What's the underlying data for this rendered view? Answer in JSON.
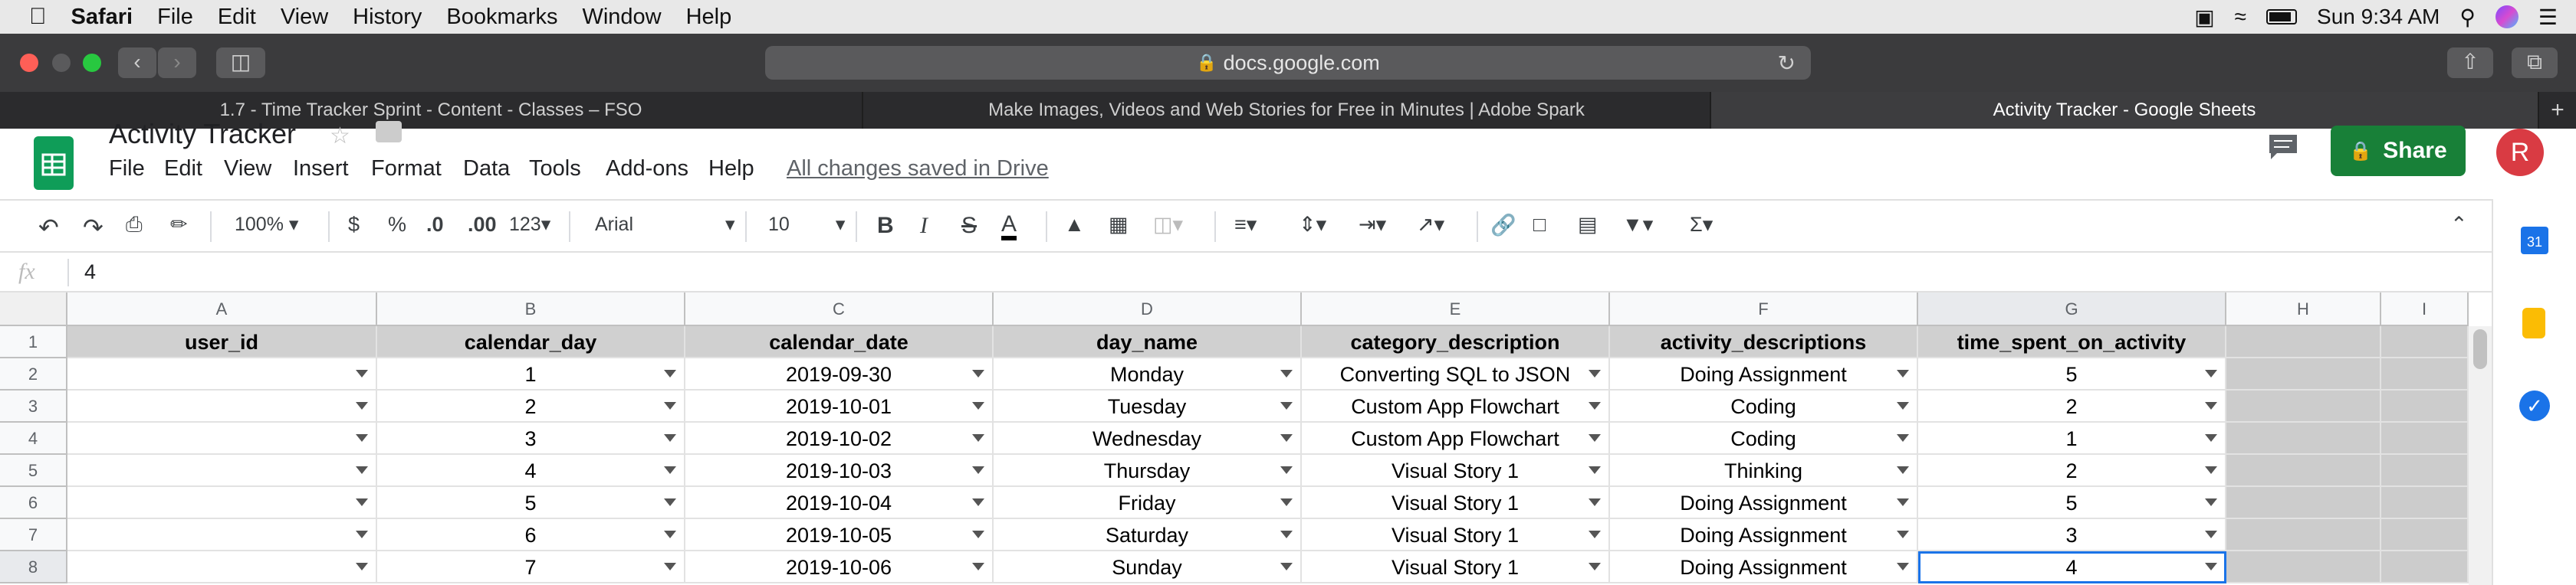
{
  "menubar": {
    "app": "Safari",
    "items": [
      "File",
      "Edit",
      "View",
      "History",
      "Bookmarks",
      "Window",
      "Help"
    ],
    "clock": "Sun 9:34 AM"
  },
  "browser": {
    "address": "docs.google.com",
    "tabs": [
      "1.7 - Time Tracker Sprint - Content - Classes – FSO",
      "Make Images, Videos and Web Stories for Free in Minutes | Adobe Spark",
      "Activity Tracker - Google Sheets"
    ],
    "active_tab": 2
  },
  "sheets": {
    "title": "Activity Tracker",
    "menu": [
      "File",
      "Edit",
      "View",
      "Insert",
      "Format",
      "Data",
      "Tools",
      "Add-ons",
      "Help"
    ],
    "saved_status": "All changes saved in Drive",
    "share_label": "Share",
    "avatar_letter": "R",
    "toolbar": {
      "zoom": "100%",
      "currency": "$",
      "percent": "%",
      "dec_less": ".0",
      "dec_more": ".00",
      "more_formats": "123",
      "font": "Arial",
      "font_size": "10",
      "bold": "B",
      "italic": "I",
      "strike": "S",
      "text_color": "A"
    },
    "formula_bar": {
      "fx": "fx",
      "value": "4"
    },
    "side_panel": {
      "calendar_day": "31"
    },
    "columns": [
      "A",
      "B",
      "C",
      "D",
      "E",
      "F",
      "G",
      "H",
      "I"
    ],
    "rows": [
      "1",
      "2",
      "3",
      "4",
      "5",
      "6",
      "7",
      "8"
    ],
    "header": [
      "user_id",
      "calendar_day",
      "calendar_date",
      "day_name",
      "category_description",
      "activity_descriptions",
      "time_spent_on_activity"
    ],
    "data": [
      [
        "",
        "1",
        "2019-09-30",
        "Monday",
        "Converting SQL to JSON",
        "Doing Assignment",
        "5"
      ],
      [
        "",
        "2",
        "2019-10-01",
        "Tuesday",
        "Custom App Flowchart",
        "Coding",
        "2"
      ],
      [
        "",
        "3",
        "2019-10-02",
        "Wednesday",
        "Custom App Flowchart",
        "Coding",
        "1"
      ],
      [
        "",
        "4",
        "2019-10-03",
        "Thursday",
        "Visual Story 1",
        "Thinking",
        "2"
      ],
      [
        "",
        "5",
        "2019-10-04",
        "Friday",
        "Visual Story 1",
        "Doing Assignment",
        "5"
      ],
      [
        "",
        "6",
        "2019-10-05",
        "Saturday",
        "Visual Story 1",
        "Doing Assignment",
        "3"
      ],
      [
        "",
        "7",
        "2019-10-06",
        "Sunday",
        "Visual Story 1",
        "Doing Assignment",
        "4"
      ]
    ],
    "colors": {
      "brand_green": "#0f9d58",
      "share_green": "#188038",
      "selection_blue": "#1a73e8",
      "header_grey": "#d0d0d0"
    }
  }
}
